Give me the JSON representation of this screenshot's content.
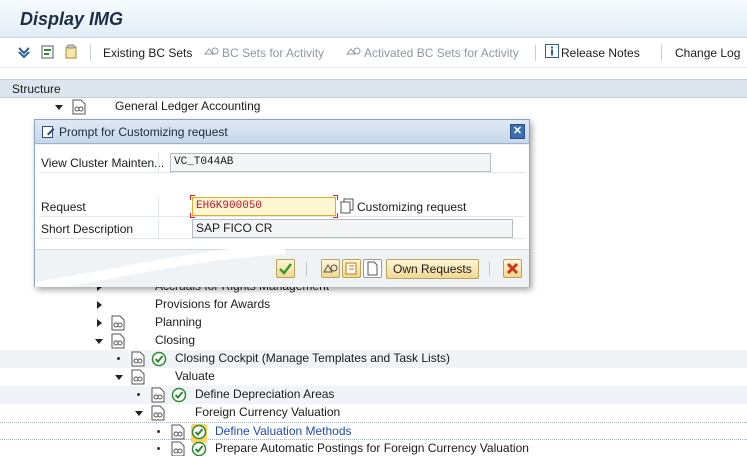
{
  "window": {
    "title": "Display IMG"
  },
  "toolbar": {
    "items": [
      {
        "label": "Existing BC Sets",
        "enabled": true
      },
      {
        "label": "BC Sets for Activity",
        "enabled": false
      },
      {
        "label": "Activated BC Sets for Activity",
        "enabled": false
      },
      {
        "label": "Release Notes",
        "enabled": true
      },
      {
        "label": "Change Log",
        "enabled": true
      }
    ]
  },
  "structure": {
    "header": "Structure",
    "rows": [
      {
        "label": "General Ledger Accounting",
        "expanded": true
      },
      {
        "label": "Accruals for Rights Management",
        "expanded": false
      },
      {
        "label": "Provisions for Awards",
        "expanded": false
      },
      {
        "label": "Planning",
        "expanded": false
      },
      {
        "label": "Closing",
        "expanded": true
      },
      {
        "label": "Closing Cockpit (Manage Templates and Task Lists)",
        "leaf": true
      },
      {
        "label": "Valuate",
        "expanded": true
      },
      {
        "label": "Define Depreciation Areas",
        "leaf": true
      },
      {
        "label": "Foreign Currency Valuation",
        "expanded": true
      },
      {
        "label": "Define Valuation Methods",
        "leaf": true,
        "selected": true
      },
      {
        "label": "Prepare Automatic Postings for Foreign Currency Valuation",
        "leaf": true
      }
    ]
  },
  "dialog": {
    "title": "Prompt for Customizing request",
    "view_label": "View Cluster Mainten...",
    "view_value": "VC_T044AB",
    "request_label": "Request",
    "request_value": "EH6K900050",
    "request_type": "Customizing request",
    "short_desc_label": "Short Description",
    "short_desc_value": "SAP FICO CR",
    "own_requests_label": "Own Requests"
  },
  "colors": {
    "accent": "#3b6fb0",
    "link": "#1a4dbb",
    "highlight": "#ffd35c"
  }
}
